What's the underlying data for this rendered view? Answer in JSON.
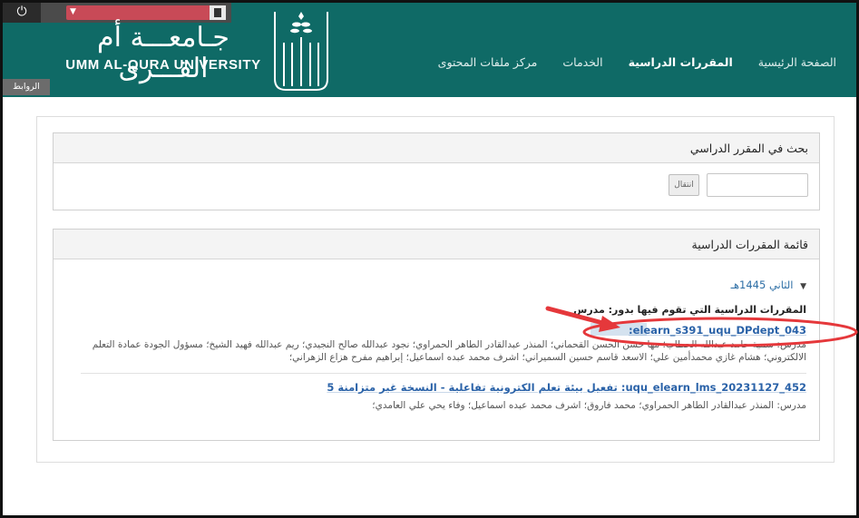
{
  "header": {
    "power_icon": "power-icon",
    "brand_ar": "جـامعـــة أم القـــرى",
    "brand_en": "UMM AL-QURA UNIVERSITY",
    "links_tab": "الروابط",
    "nav": {
      "home": "الصفحة الرئيسية",
      "courses": "المقررات الدراسية",
      "services": "الخدمات",
      "content_center": "مركز ملفات المحتوى"
    },
    "colors": {
      "header_bg": "#0f6a66",
      "annotation": "#e5383b"
    }
  },
  "search_panel": {
    "title": "بحث في المقرر الدراسي",
    "go_label": "انتقال"
  },
  "course_list": {
    "title": "قائمة المقررات الدراسية",
    "term": "الثاني 1445هـ",
    "role_heading": "المقررات الدراسية التي تقوم فيها بدور: مدرس",
    "courses": [
      {
        "title": "elearn_s391_uqu_DPdept_043:",
        "instructors": "مدرس: سمية حامد عبدالله الحطاب؛ مها حسن الحسن القحماني؛ المنذر عبدالقادر الطاهر الحمراوي؛ نجود عبدالله صالح النجيدي؛ ريم عبدالله فهيد الشيخ؛ مسؤول الجودة عمادة التعلم الالكتروني؛ هشام غازي محمدأمين علي؛ الاسعد قاسم حسين السميراني؛ اشرف محمد عبده اسماعيل؛ إبراهيم مفرح هزاع الزهراني؛"
      },
      {
        "title": "uqu_elearn_lms_20231127_452: تفعيل بيئة تعلم الكترونية تفاعلية - النسخة غير متزامنة 5",
        "instructors": "مدرس: المنذر عبدالقادر الطاهر الحمراوي؛ محمد فاروق؛ اشرف محمد عبده اسماعيل؛ وفاء يحي علي العامدي؛"
      }
    ]
  }
}
